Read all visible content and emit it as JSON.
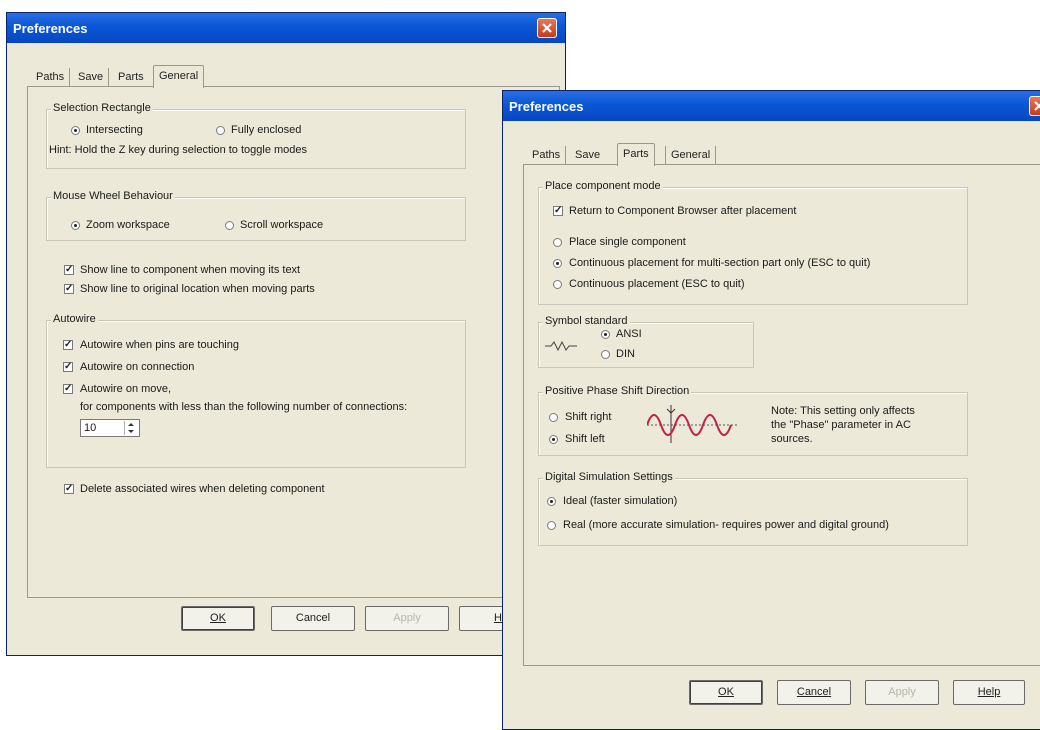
{
  "dialog1": {
    "title": "Preferences",
    "tabs": [
      "Paths",
      "Save",
      "Parts",
      "General"
    ],
    "selection_rectangle": {
      "title": "Selection Rectangle",
      "option1": "Intersecting",
      "option2": "Fully enclosed",
      "hint": "Hint: Hold the Z key during selection to toggle modes"
    },
    "mouse_wheel": {
      "title": "Mouse Wheel Behaviour",
      "option1": "Zoom workspace",
      "option2": "Scroll workspace"
    },
    "show_line_text": "Show line to component when moving its text",
    "show_line_parts": "Show line to original location when moving parts",
    "autowire": {
      "title": "Autowire",
      "pins": "Autowire when pins are touching",
      "connection": "Autowire on connection",
      "move": "Autowire on move,",
      "move_note": "for components with less than the following number of connections:",
      "connections_value": "10"
    },
    "delete_wires": "Delete associated wires when deleting component",
    "buttons": {
      "ok": "OK",
      "cancel": "Cancel",
      "apply": "Apply",
      "help": "He"
    }
  },
  "dialog2": {
    "title": "Preferences",
    "tabs": [
      "Paths",
      "Save",
      "Parts",
      "General"
    ],
    "place_mode": {
      "title": "Place component mode",
      "return_to_browser": "Return to Component Browser after placement",
      "single": "Place single component",
      "continuous_multi": "Continuous placement for multi-section part only (ESC to quit)",
      "continuous": "Continuous placement (ESC to quit)"
    },
    "symbol_standard": {
      "title": "Symbol standard",
      "ansi": "ANSI",
      "din": "DIN"
    },
    "phase_shift": {
      "title": "Positive Phase Shift Direction",
      "right": "Shift right",
      "left": "Shift left",
      "note_line1": "Note: This setting only affects",
      "note_line2": "the \"Phase\" parameter in AC",
      "note_line3": "sources."
    },
    "digital_sim": {
      "title": "Digital Simulation Settings",
      "ideal": "Ideal (faster simulation)",
      "real": "Real (more accurate simulation- requires power and digital ground)"
    },
    "buttons": {
      "ok": "OK",
      "cancel": "Cancel",
      "apply": "Apply",
      "help": "Help"
    }
  },
  "colors": {
    "title_bar": "#0a57d6",
    "dialog_face": "#ece9d8",
    "close_button": "#c53b1c",
    "waveform": "#c0204a"
  }
}
